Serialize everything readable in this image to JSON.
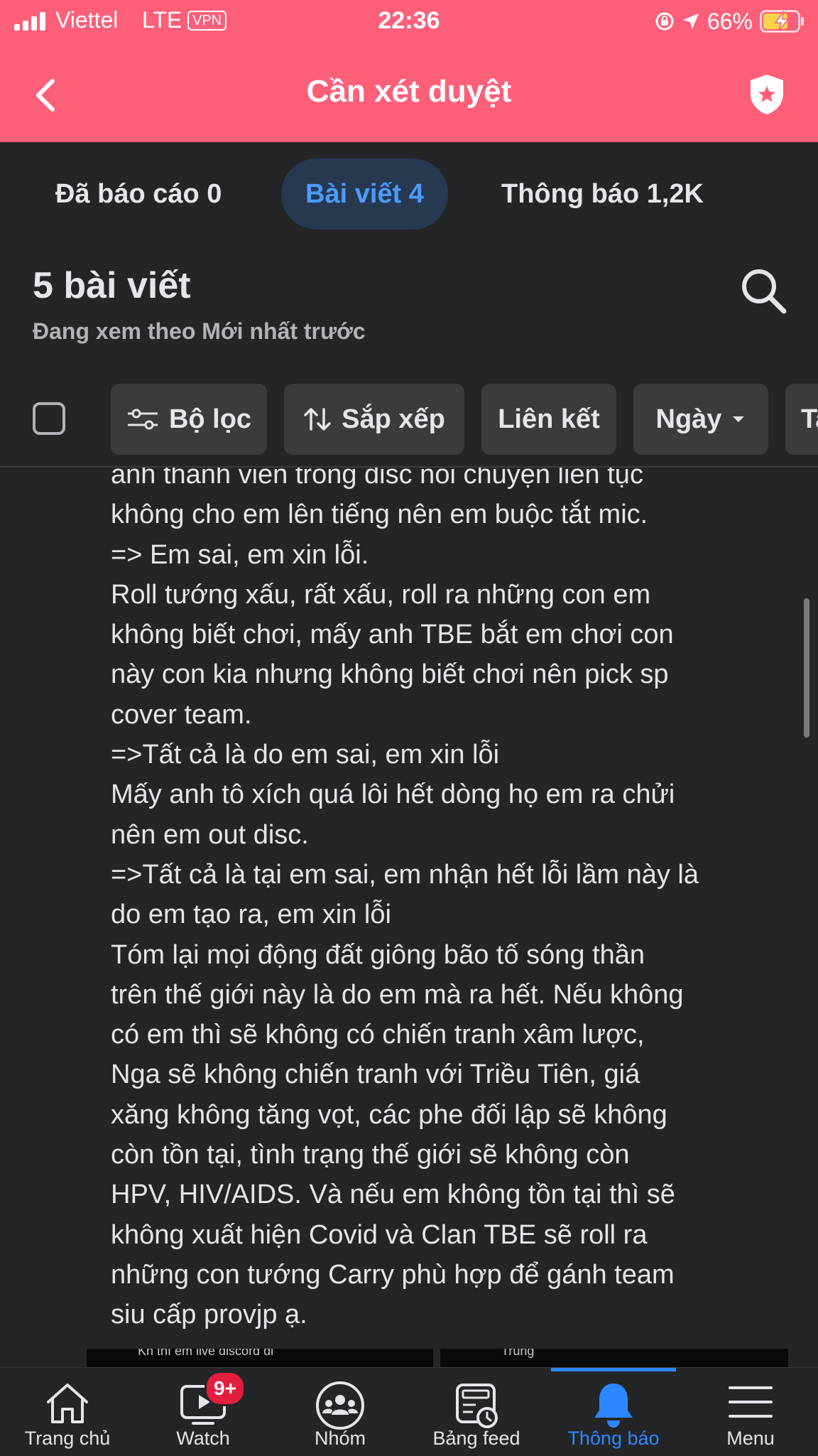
{
  "status": {
    "carrier": "Viettel",
    "network": "LTE",
    "vpn": "VPN",
    "time": "22:36",
    "battery": "66%"
  },
  "header": {
    "title": "Cần xét duyệt",
    "back_icon": "chevron-left-icon",
    "shield_icon": "shield-star-icon"
  },
  "tabs": [
    {
      "label": "Đã báo cáo 0"
    },
    {
      "label": "Bài viết 4"
    },
    {
      "label": "Thông báo 1,2K"
    }
  ],
  "section": {
    "title": "5 bài viết",
    "subtitle": "Đang xem theo Mới nhất trước"
  },
  "filters": {
    "filter": "Bộ lọc",
    "sort": "Sắp xếp",
    "link": "Liên kết",
    "date": "Ngày",
    "next": "Ta"
  },
  "post_lines": [
    "anh thành viên trong disc nói chuyện liên tục",
    "không cho em lên tiếng nên em buộc tắt mic.",
    "=> Em sai, em xin lỗi.",
    "Roll tướng xấu, rất xấu, roll ra những con em",
    "không biết chơi, mấy anh TBE bắt em chơi con",
    "này con kia nhưng không biết chơi nên pick sp",
    "cover team.",
    "=>Tất cả là do em sai, em xin lỗi",
    "Mấy anh tô xích quá lôi hết dòng họ em ra chửi",
    "nên em out disc.",
    "=>Tất cả là tại em sai, em nhận hết lỗi lầm này là",
    "do em tạo ra, em xin lỗi",
    "Tóm lại mọi động đất giông bão tố sóng thần",
    "trên thế giới này là do em mà ra hết. Nếu không",
    "có em thì sẽ không có chiến tranh xâm lược,",
    "Nga sẽ không chiến tranh với Triều Tiên, giá",
    "xăng không tăng vọt, các phe đối lập sẽ không",
    "còn tồn tại, tình trạng thế giới sẽ không còn",
    "HPV, HIV/AIDS. Và nếu em không tồn tại thì sẽ",
    "không xuất hiện Covid và Clan TBE sẽ roll ra",
    "những con tướng Carry phù hợp để gánh team",
    "siu cấp provjp ạ."
  ],
  "thumbnails": [
    {
      "caption": "Kh thì em live discord đi"
    },
    {
      "caption": "Trung"
    }
  ],
  "nav": [
    {
      "label": "Trang chủ",
      "icon": "home-icon"
    },
    {
      "label": "Watch",
      "icon": "watch-icon",
      "badge": "9+"
    },
    {
      "label": "Nhóm",
      "icon": "groups-icon"
    },
    {
      "label": "Bảng feed",
      "icon": "feed-icon"
    },
    {
      "label": "Thông báo",
      "icon": "bell-icon"
    },
    {
      "label": "Menu",
      "icon": "menu-icon"
    }
  ],
  "colors": {
    "header": "#fd5f79",
    "background": "#242527",
    "accent": "#2d88ff",
    "chip": "#3a3b3c"
  }
}
